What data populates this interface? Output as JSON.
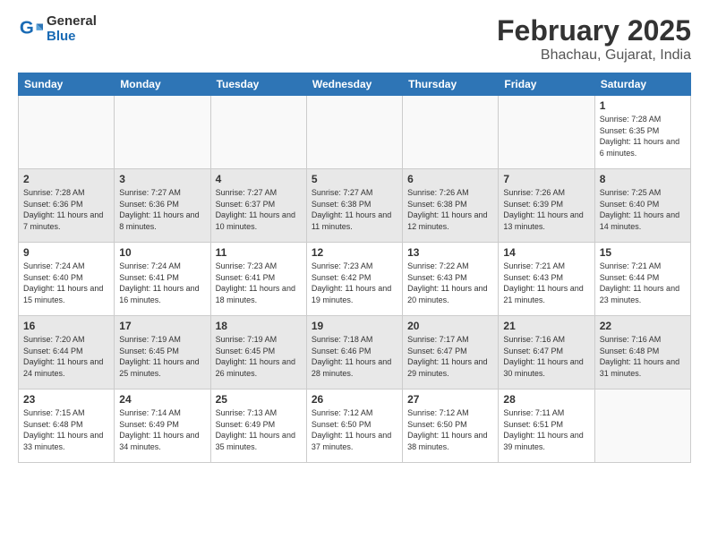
{
  "logo": {
    "general": "General",
    "blue": "Blue"
  },
  "title": "February 2025",
  "subtitle": "Bhachau, Gujarat, India",
  "weekdays": [
    "Sunday",
    "Monday",
    "Tuesday",
    "Wednesday",
    "Thursday",
    "Friday",
    "Saturday"
  ],
  "weeks": [
    [
      {
        "day": "",
        "info": ""
      },
      {
        "day": "",
        "info": ""
      },
      {
        "day": "",
        "info": ""
      },
      {
        "day": "",
        "info": ""
      },
      {
        "day": "",
        "info": ""
      },
      {
        "day": "",
        "info": ""
      },
      {
        "day": "1",
        "info": "Sunrise: 7:28 AM\nSunset: 6:35 PM\nDaylight: 11 hours and 6 minutes."
      }
    ],
    [
      {
        "day": "2",
        "info": "Sunrise: 7:28 AM\nSunset: 6:36 PM\nDaylight: 11 hours and 7 minutes."
      },
      {
        "day": "3",
        "info": "Sunrise: 7:27 AM\nSunset: 6:36 PM\nDaylight: 11 hours and 8 minutes."
      },
      {
        "day": "4",
        "info": "Sunrise: 7:27 AM\nSunset: 6:37 PM\nDaylight: 11 hours and 10 minutes."
      },
      {
        "day": "5",
        "info": "Sunrise: 7:27 AM\nSunset: 6:38 PM\nDaylight: 11 hours and 11 minutes."
      },
      {
        "day": "6",
        "info": "Sunrise: 7:26 AM\nSunset: 6:38 PM\nDaylight: 11 hours and 12 minutes."
      },
      {
        "day": "7",
        "info": "Sunrise: 7:26 AM\nSunset: 6:39 PM\nDaylight: 11 hours and 13 minutes."
      },
      {
        "day": "8",
        "info": "Sunrise: 7:25 AM\nSunset: 6:40 PM\nDaylight: 11 hours and 14 minutes."
      }
    ],
    [
      {
        "day": "9",
        "info": "Sunrise: 7:24 AM\nSunset: 6:40 PM\nDaylight: 11 hours and 15 minutes."
      },
      {
        "day": "10",
        "info": "Sunrise: 7:24 AM\nSunset: 6:41 PM\nDaylight: 11 hours and 16 minutes."
      },
      {
        "day": "11",
        "info": "Sunrise: 7:23 AM\nSunset: 6:41 PM\nDaylight: 11 hours and 18 minutes."
      },
      {
        "day": "12",
        "info": "Sunrise: 7:23 AM\nSunset: 6:42 PM\nDaylight: 11 hours and 19 minutes."
      },
      {
        "day": "13",
        "info": "Sunrise: 7:22 AM\nSunset: 6:43 PM\nDaylight: 11 hours and 20 minutes."
      },
      {
        "day": "14",
        "info": "Sunrise: 7:21 AM\nSunset: 6:43 PM\nDaylight: 11 hours and 21 minutes."
      },
      {
        "day": "15",
        "info": "Sunrise: 7:21 AM\nSunset: 6:44 PM\nDaylight: 11 hours and 23 minutes."
      }
    ],
    [
      {
        "day": "16",
        "info": "Sunrise: 7:20 AM\nSunset: 6:44 PM\nDaylight: 11 hours and 24 minutes."
      },
      {
        "day": "17",
        "info": "Sunrise: 7:19 AM\nSunset: 6:45 PM\nDaylight: 11 hours and 25 minutes."
      },
      {
        "day": "18",
        "info": "Sunrise: 7:19 AM\nSunset: 6:45 PM\nDaylight: 11 hours and 26 minutes."
      },
      {
        "day": "19",
        "info": "Sunrise: 7:18 AM\nSunset: 6:46 PM\nDaylight: 11 hours and 28 minutes."
      },
      {
        "day": "20",
        "info": "Sunrise: 7:17 AM\nSunset: 6:47 PM\nDaylight: 11 hours and 29 minutes."
      },
      {
        "day": "21",
        "info": "Sunrise: 7:16 AM\nSunset: 6:47 PM\nDaylight: 11 hours and 30 minutes."
      },
      {
        "day": "22",
        "info": "Sunrise: 7:16 AM\nSunset: 6:48 PM\nDaylight: 11 hours and 31 minutes."
      }
    ],
    [
      {
        "day": "23",
        "info": "Sunrise: 7:15 AM\nSunset: 6:48 PM\nDaylight: 11 hours and 33 minutes."
      },
      {
        "day": "24",
        "info": "Sunrise: 7:14 AM\nSunset: 6:49 PM\nDaylight: 11 hours and 34 minutes."
      },
      {
        "day": "25",
        "info": "Sunrise: 7:13 AM\nSunset: 6:49 PM\nDaylight: 11 hours and 35 minutes."
      },
      {
        "day": "26",
        "info": "Sunrise: 7:12 AM\nSunset: 6:50 PM\nDaylight: 11 hours and 37 minutes."
      },
      {
        "day": "27",
        "info": "Sunrise: 7:12 AM\nSunset: 6:50 PM\nDaylight: 11 hours and 38 minutes."
      },
      {
        "day": "28",
        "info": "Sunrise: 7:11 AM\nSunset: 6:51 PM\nDaylight: 11 hours and 39 minutes."
      },
      {
        "day": "",
        "info": ""
      }
    ]
  ]
}
